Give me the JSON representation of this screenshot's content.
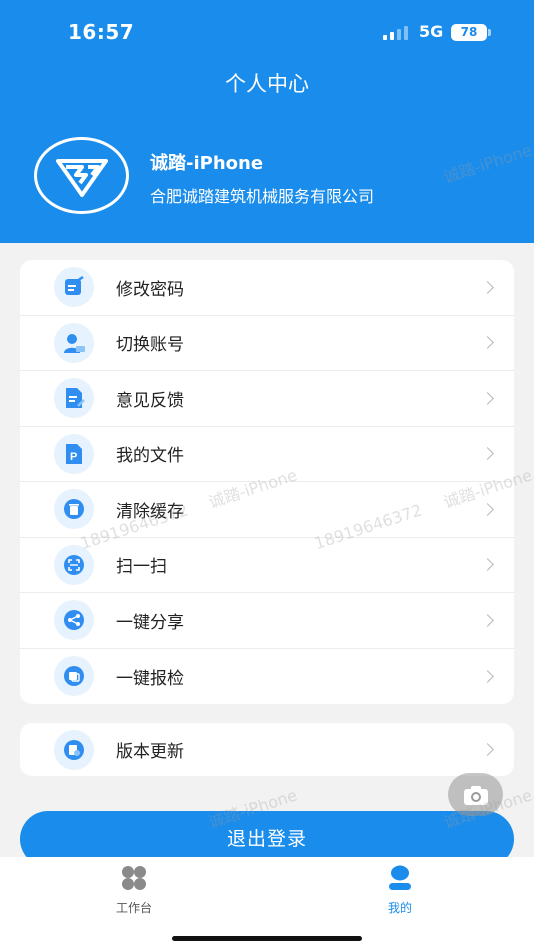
{
  "status_bar": {
    "time": "16:57",
    "network": "5G",
    "battery": "78"
  },
  "header": {
    "title": "个人中心",
    "user_name": "诚踏-iPhone",
    "company": "合肥诚踏建筑机械服务有限公司"
  },
  "menu": [
    {
      "label": "修改密码",
      "icon": "edit-password-icon"
    },
    {
      "label": "切换账号",
      "icon": "switch-account-icon"
    },
    {
      "label": "意见反馈",
      "icon": "feedback-icon"
    },
    {
      "label": "我的文件",
      "icon": "file-icon"
    },
    {
      "label": "清除缓存",
      "icon": "trash-icon"
    },
    {
      "label": "扫一扫",
      "icon": "scan-icon"
    },
    {
      "label": "一键分享",
      "icon": "share-icon"
    },
    {
      "label": "一键报检",
      "icon": "report-icon"
    }
  ],
  "update_item": {
    "label": "版本更新",
    "icon": "update-icon"
  },
  "logout_label": "退出登录",
  "tabs": [
    {
      "label": "工作台",
      "icon": "grid-icon",
      "active": false
    },
    {
      "label": "我的",
      "icon": "user-icon",
      "active": true
    }
  ],
  "watermarks": {
    "name": "诚踏-iPhone",
    "phone": "18919646372"
  },
  "colors": {
    "accent": "#1a8cec",
    "background": "#f2f2f2"
  }
}
